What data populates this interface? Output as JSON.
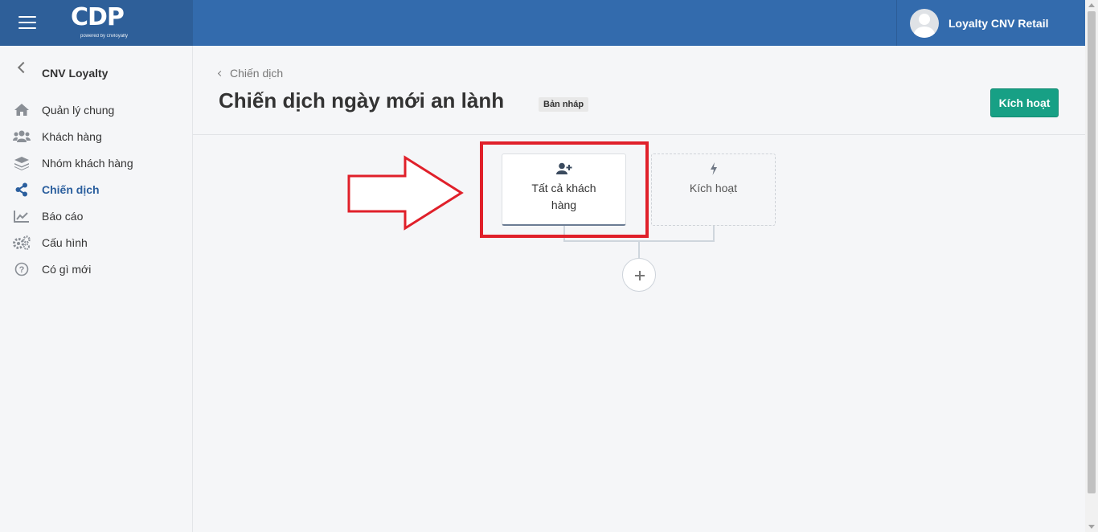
{
  "header": {
    "logo_text": "CDP",
    "logo_subtext": "powered by cnvloyalty",
    "user_name": "Loyalty CNV Retail"
  },
  "sidebar": {
    "back_label": "CNV Loyalty",
    "items": [
      {
        "label": "Quản lý chung",
        "icon": "home-icon"
      },
      {
        "label": "Khách hàng",
        "icon": "users-icon"
      },
      {
        "label": "Nhóm khách hàng",
        "icon": "layers-icon"
      },
      {
        "label": "Chiến dịch",
        "icon": "share-icon",
        "active": true
      },
      {
        "label": "Báo cáo",
        "icon": "chart-icon"
      },
      {
        "label": "Cấu hình",
        "icon": "gears-icon"
      },
      {
        "label": "Có gì mới",
        "icon": "question-icon"
      }
    ]
  },
  "main": {
    "breadcrumb": "Chiến dịch",
    "title": "Chiến dịch ngày mới an lành",
    "status_badge": "Bản nháp",
    "activate_button": "Kích hoạt",
    "flow": {
      "audience_node": {
        "label": "Tất cả khách hàng",
        "icon": "user-plus-icon"
      },
      "trigger_node": {
        "label": "Kích hoạt",
        "icon": "bolt-icon"
      },
      "add_step_icon": "plus-icon"
    }
  },
  "annotation": {
    "color": "#e0202a",
    "shapes": [
      "arrow",
      "rectangle"
    ]
  },
  "colors": {
    "topbar": "#336bad",
    "accent_green": "#17a085",
    "active_nav": "#2b5f9e"
  }
}
